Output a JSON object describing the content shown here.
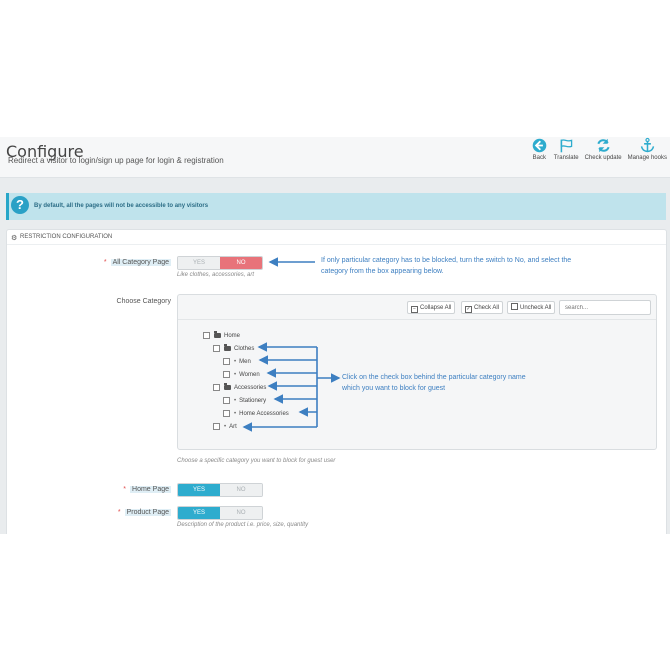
{
  "header": {
    "title": "Configure",
    "subtitle": "Redirect a visitor to login/sign up page for login & registration",
    "tools": [
      {
        "label": "Back",
        "icon": "back-icon"
      },
      {
        "label": "Translate",
        "icon": "flag-icon"
      },
      {
        "label": "Check update",
        "icon": "refresh-icon"
      },
      {
        "label": "Manage hooks",
        "icon": "anchor-icon"
      }
    ]
  },
  "info": {
    "text": "By default, all the pages will not be accessible to any visitors"
  },
  "panel": {
    "title": "RESTRICTION CONFIGURATION",
    "all_category": {
      "label": "All Category Page",
      "yes": "YES",
      "no": "NO",
      "value": "NO",
      "help": "Like clothes, accessories, art"
    },
    "choose_category": {
      "label": "Choose Category",
      "collapse_label": "Collapse All",
      "check_label": "Check All",
      "uncheck_label": "Uncheck All",
      "search_placeholder": "search...",
      "tree": [
        {
          "label": "Home"
        },
        {
          "label": "Clothes"
        },
        {
          "label": "Men"
        },
        {
          "label": "Women"
        },
        {
          "label": "Accessories"
        },
        {
          "label": "Stationery"
        },
        {
          "label": "Home Accessories"
        },
        {
          "label": "Art"
        }
      ],
      "help": "Choose a specific category you want to block for guest user"
    },
    "home_page": {
      "label": "Home Page",
      "yes": "YES",
      "no": "NO",
      "value": "YES"
    },
    "product_page": {
      "label": "Product Page",
      "yes": "YES",
      "no": "NO",
      "value": "YES",
      "help": "Description of the product i.e. price, size, quantity"
    }
  },
  "annotations": {
    "switch_note_line1": "If only particular category has to be blocked, turn the switch to No, and select the",
    "switch_note_line2": "category from the box appearing below.",
    "tree_note_line1": "Click on the check box behind the particular category name",
    "tree_note_line2": "which you want to block for guest"
  },
  "colors": {
    "accent": "#2eacce",
    "no_red": "#e8737a",
    "annotation_blue": "#3d7fc1"
  }
}
